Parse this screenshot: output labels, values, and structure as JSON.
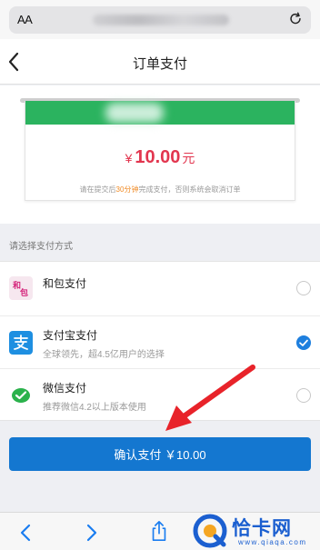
{
  "browser": {
    "aa_label": "AA",
    "reload_icon": "reload-icon"
  },
  "header": {
    "title": "订单支付",
    "back_icon": "chevron-left-icon"
  },
  "receipt": {
    "currency": "¥",
    "amount": "10.00",
    "unit": "元",
    "notice_before": "请在提交后",
    "notice_highlight": "30分钟",
    "notice_after": "完成支付，否则系统会取消订单",
    "band_color": "#2bb35f",
    "amount_color": "#e2364f"
  },
  "payment": {
    "section_label": "请选择支付方式",
    "methods": [
      {
        "name": "和包支付",
        "desc": "",
        "icon": "hebao-icon",
        "checked": false
      },
      {
        "name": "支付宝支付",
        "desc": "全球领先，超4.5亿用户的选择",
        "icon": "alipay-icon",
        "checked": true
      },
      {
        "name": "微信支付",
        "desc": "推荐微信4.2以上版本使用",
        "icon": "wechat-pay-icon",
        "checked": false
      }
    ]
  },
  "confirm": {
    "label": "确认支付 ￥10.00",
    "color": "#1477d0"
  },
  "toolbar": {
    "back_icon": "chevron-left-icon",
    "forward_icon": "chevron-right-icon",
    "share_icon": "share-icon"
  },
  "watermark": {
    "text": "恰卡网",
    "url": "www.qiaqa.com"
  }
}
